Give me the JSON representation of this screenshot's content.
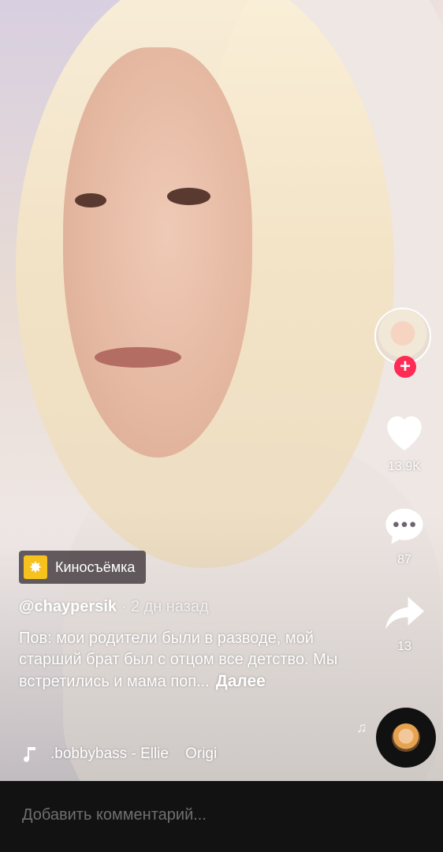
{
  "video": {
    "effect": {
      "icon": "sparkle-icon",
      "label": "Киносъёмка"
    },
    "author": {
      "username": "@chaypersik",
      "separator": "·",
      "posted": "2 дн назад"
    },
    "caption": {
      "text": "Пов: мои родители были в разводе, мой старший брат был с отцом все детство. Мы встретились и мама поп...",
      "more": "Далее"
    },
    "music": {
      "icon": "music-note-icon",
      "text": ".bobbybass - Ellie    Origi"
    }
  },
  "actions": {
    "follow": {
      "icon": "plus-icon"
    },
    "like": {
      "icon": "heart-icon",
      "count": "13.9K"
    },
    "comment": {
      "icon": "comment-bubble-icon",
      "count": "87"
    },
    "share": {
      "icon": "share-arrow-icon",
      "count": "13"
    }
  },
  "comment_bar": {
    "placeholder": "Добавить комментарий..."
  },
  "colors": {
    "accent": "#fe2c55",
    "effect_icon_bg": "#f6c21e",
    "comment_bar_bg": "#121212"
  }
}
